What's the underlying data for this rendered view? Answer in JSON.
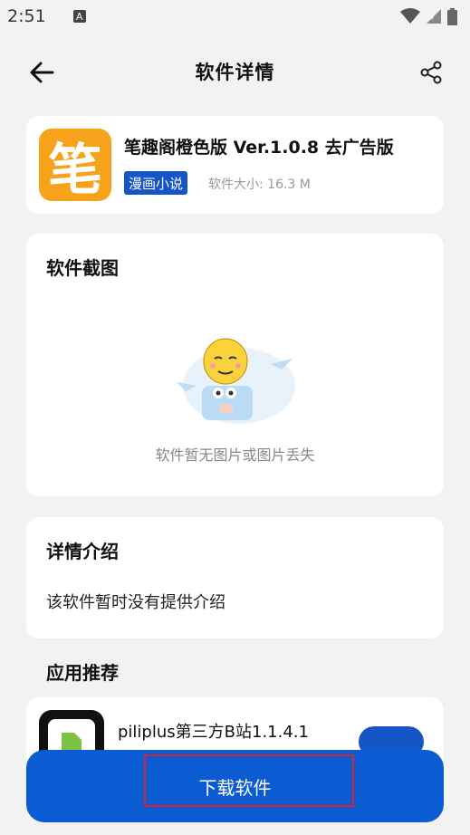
{
  "status_bar": {
    "time": "2:51",
    "notification_icon": "A"
  },
  "header": {
    "title": "软件详情",
    "back_icon": "arrow-left-icon",
    "share_icon": "share-icon"
  },
  "app": {
    "icon_glyph": "笔",
    "name": "笔趣阁橙色版 Ver.1.0.8 去广告版",
    "category": "漫画小说",
    "size": "软件大小: 16.3 M"
  },
  "screenshots": {
    "title": "软件截图",
    "empty_text": "软件暂无图片或图片丢失"
  },
  "details": {
    "title": "详情介绍",
    "text": "该软件暂时没有提供介绍"
  },
  "recommend": {
    "title": "应用推荐",
    "items": [
      {
        "name": "piliplus第三方B站1.1.4.1"
      }
    ]
  },
  "download": {
    "label": "下载软件"
  },
  "colors": {
    "accent": "#0b5bd3",
    "badge": "#1456c8",
    "highlight": "#e0202a",
    "app_icon_bg": "#f7a21b"
  }
}
